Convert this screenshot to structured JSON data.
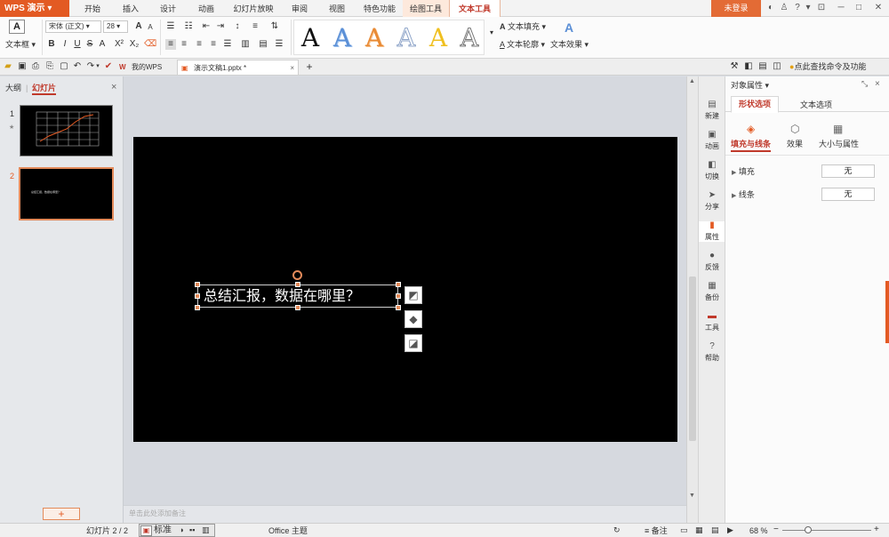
{
  "app": {
    "name": "WPS 演示",
    "arrow": "▾"
  },
  "tabs": [
    "开始",
    "插入",
    "设计",
    "动画",
    "幻灯片放映",
    "审阅",
    "视图",
    "特色功能",
    "绘图工具",
    "文本工具"
  ],
  "login": "未登录",
  "ribbon": {
    "textbox": "文本框",
    "font": "宋体 (正文)",
    "size": "28",
    "bold": "B",
    "italic": "I",
    "underline": "U",
    "strike": "S",
    "grow": "A",
    "shrink": "A",
    "superscript": "X²",
    "subscript": "X₂",
    "wordart": [
      "A",
      "A",
      "A",
      "A",
      "A",
      "A"
    ],
    "text_fill": "文本填充",
    "text_outline": "文本轮廓",
    "text_effect": "文本效果"
  },
  "doctabs": {
    "mywps": "我的WPS",
    "doc": "演示文稿1.pptx *",
    "add": "+"
  },
  "search": "点此查找命令及功能",
  "left": {
    "outline": "大纲",
    "slides": "幻灯片",
    "close": "×",
    "nums": [
      "1",
      "2"
    ],
    "star": "★",
    "add": "+",
    "thumb2_text": "总结汇报，数据在哪里？"
  },
  "slide": {
    "text": "总结汇报，数据在哪里？"
  },
  "notes": "单击此处添加备注",
  "sidebar": [
    "新建",
    "动画",
    "切换",
    "分享",
    "属性",
    "反馈",
    "备份",
    "工具",
    "帮助"
  ],
  "props": {
    "title": "对象属性",
    "tabs": [
      "形状选项",
      "文本选项"
    ],
    "subtabs": [
      "填充与线条",
      "效果",
      "大小与属性"
    ],
    "rows": [
      {
        "label": "填充",
        "value": "无"
      },
      {
        "label": "线条",
        "value": "无"
      }
    ]
  },
  "status": {
    "slide": "幻灯片 2 / 2",
    "view": "标准",
    "theme": "Office 主题",
    "notes": "备注",
    "zoom": "68 %"
  },
  "colors": {
    "accent": "#e35a23",
    "wa": [
      "#111111",
      "#5b8fd6",
      "#e88a35",
      "#8fa5c9",
      "#f0c020",
      "#777777"
    ]
  }
}
